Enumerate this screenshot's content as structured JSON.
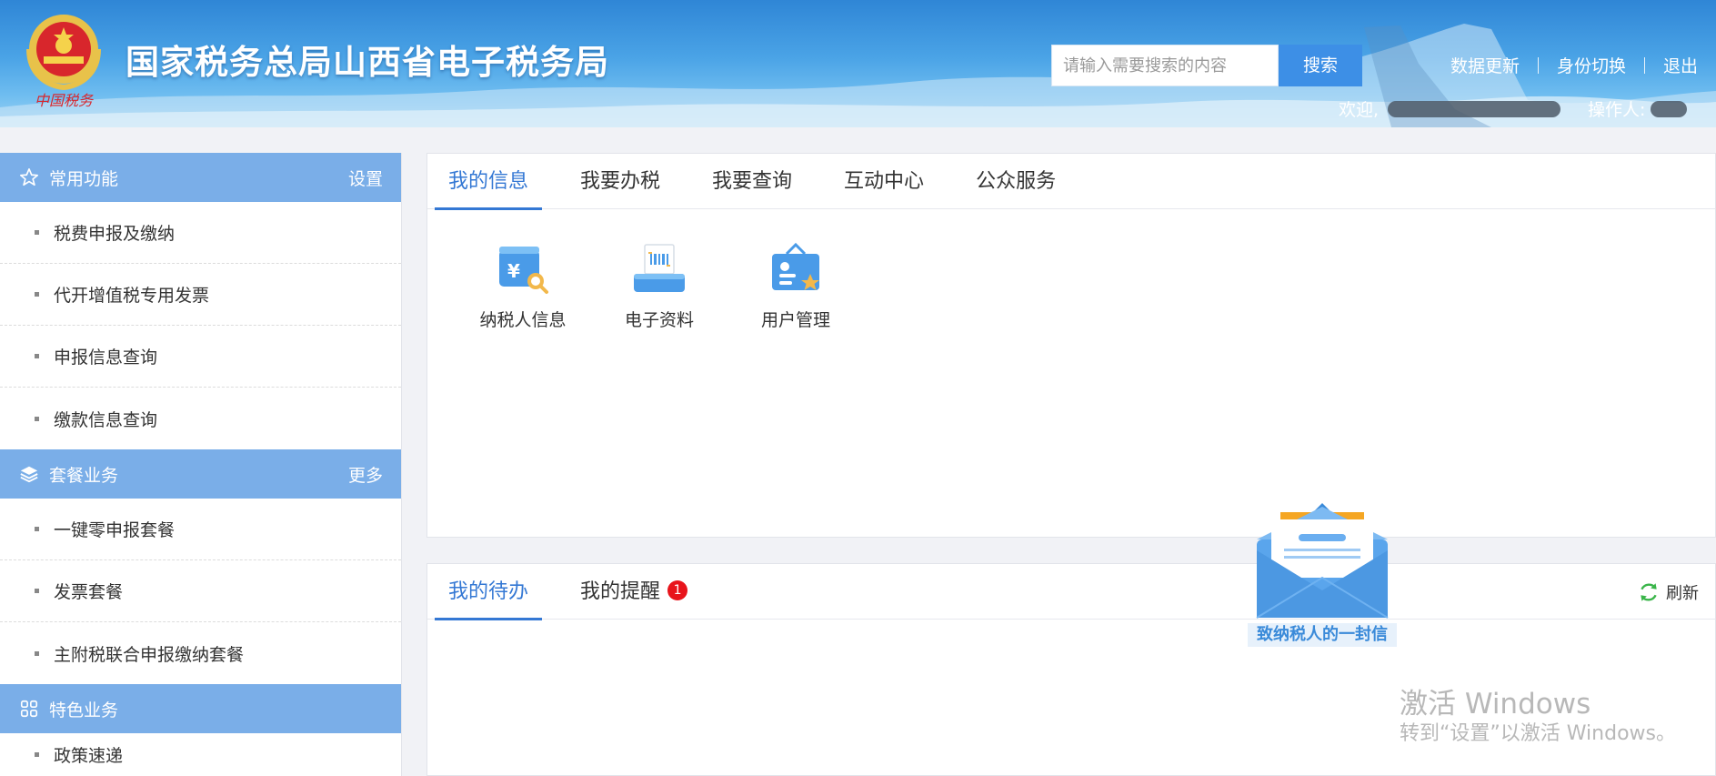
{
  "header": {
    "title": "国家税务总局山西省电子税务局",
    "emblem_text": "中国税务",
    "search_placeholder": "请输入需要搜索的内容",
    "search_button": "搜索",
    "links": [
      "数据更新",
      "身份切换",
      "退出"
    ],
    "welcome_label": "欢迎,",
    "operator_label": "操作人:"
  },
  "sidebar": {
    "sections": [
      {
        "title": "常用功能",
        "action": "设置",
        "icon": "star-icon",
        "items": [
          "税费申报及缴纳",
          "代开增值税专用发票",
          "申报信息查询",
          "缴款信息查询"
        ]
      },
      {
        "title": "套餐业务",
        "action": "更多",
        "icon": "layers-icon",
        "items": [
          "一键零申报套餐",
          "发票套餐",
          "主附税联合申报缴纳套餐"
        ]
      },
      {
        "title": "特色业务",
        "action": "",
        "icon": "grid-icon",
        "items": [
          "政策速递"
        ]
      }
    ]
  },
  "main": {
    "tabs": [
      "我的信息",
      "我要办税",
      "我要查询",
      "互动中心",
      "公众服务"
    ],
    "apps": [
      {
        "label": "纳税人信息",
        "icon": "taxpayer-info-icon"
      },
      {
        "label": "电子资料",
        "icon": "e-document-icon"
      },
      {
        "label": "用户管理",
        "icon": "user-manage-icon"
      }
    ],
    "lower_tabs": [
      "我的待办",
      "我的提醒"
    ],
    "reminder_count": "1",
    "refresh_label": "刷新"
  },
  "letter": {
    "caption": "致纳税人的一封信"
  },
  "watermark": {
    "line1": "激活 Windows",
    "line2": "转到“设置”以激活 Windows。"
  },
  "colors": {
    "header_blue": "#2f86d6",
    "section_blue": "#7aaee8",
    "accent": "#3478d4",
    "badge_red": "#e8141b"
  }
}
